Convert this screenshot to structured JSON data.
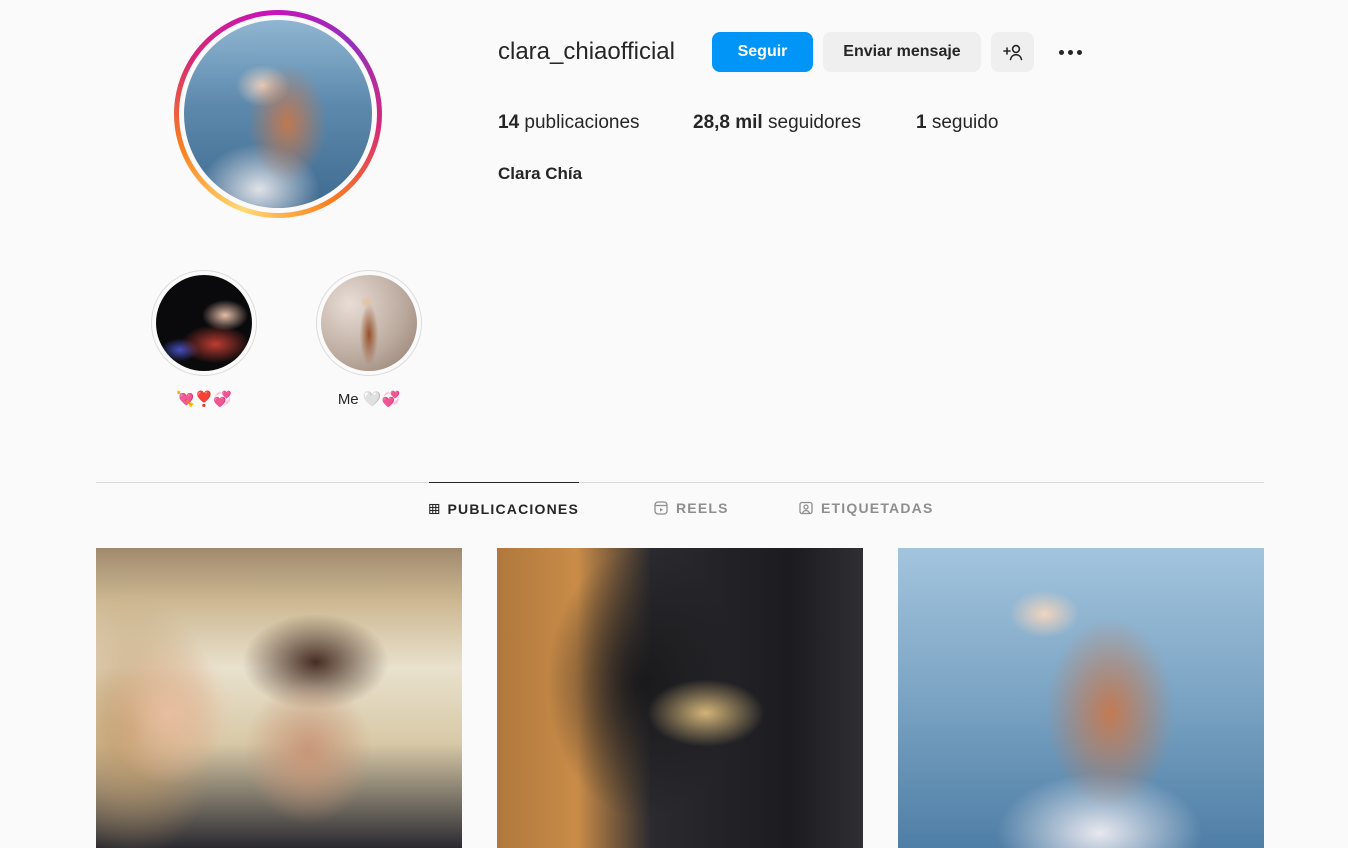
{
  "profile": {
    "username": "clara_chiaofficial",
    "full_name": "Clara Chía",
    "avatar_ring_colors": [
      "#feda75",
      "#fa7e1e",
      "#d62976",
      "#962fbf"
    ]
  },
  "actions": {
    "follow_label": "Seguir",
    "message_label": "Enviar mensaje",
    "add_user_icon": "add-user-icon",
    "more_icon": "more-options-icon",
    "follow_color": "#0095f6"
  },
  "stats": [
    {
      "count": "14",
      "label": "publicaciones"
    },
    {
      "count": "28,8 mil",
      "label": "seguidores"
    },
    {
      "count": "1",
      "label": "seguido"
    }
  ],
  "highlights": [
    {
      "label": "💘❣️💞"
    },
    {
      "label_text": "Me",
      "label_emoji": "🤍💞"
    }
  ],
  "tabs": [
    {
      "label": "PUBLICACIONES",
      "icon": "grid-icon",
      "active": true
    },
    {
      "label": "REELS",
      "icon": "reels-icon",
      "active": false
    },
    {
      "label": "ETIQUETADAS",
      "icon": "tagged-icon",
      "active": false
    }
  ]
}
